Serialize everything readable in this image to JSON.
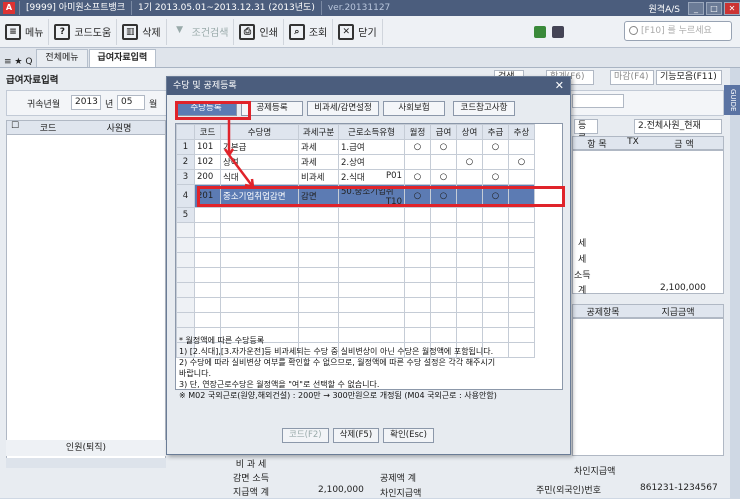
{
  "titlebar": {
    "app": "A",
    "company": "[9999] 아미원소프트뱅크",
    "period": "1기 2013.05.01~2013.12.31 (2013년도)",
    "version": "ver.20131127",
    "remote": "원격A/S"
  },
  "toolbar": {
    "items": [
      {
        "label": "메뉴",
        "icon": "menu-icon"
      },
      {
        "label": "코드도움",
        "icon": "help-icon"
      },
      {
        "label": "삭제",
        "icon": "trash-icon"
      },
      {
        "label": "조건검색",
        "icon": "filter-icon"
      },
      {
        "label": "인쇄",
        "icon": "print-icon"
      },
      {
        "label": "조회",
        "icon": "search-icon"
      },
      {
        "label": "닫기",
        "icon": "close-icon"
      }
    ],
    "search_placeholder": "[F10] 를 누르세요"
  },
  "tabs": [
    {
      "label": "전체메뉴"
    },
    {
      "label": "급여자료입력"
    }
  ],
  "bg": {
    "title": "급여자료입력",
    "year_label": "귀속년월",
    "year": "2013",
    "year_unit": "년",
    "month": "05",
    "month_unit": "월",
    "top_buttons": [
      "검색",
      "합계(F6)",
      "마감(F4)",
      "기능모음(F11)"
    ],
    "right_combo": "2.전체사원_현재",
    "right_btn": "등록",
    "col_code": "코드",
    "col_name": "사원명",
    "rh_item": "항 목",
    "rh_tx": "TX",
    "rh_amount": "금 액",
    "rows": [
      "세",
      "세",
      "소득",
      "계"
    ],
    "total": "2,100,000",
    "ded_item": "공제항목",
    "ded_amount": "지급금액",
    "left_footer": "인원(퇴직)",
    "bottom": [
      {
        "l": "비 과 세",
        "v": ""
      },
      {
        "l": "감면 소득",
        "v": ""
      },
      {
        "l": "지급액 계",
        "v": "2,100,000"
      }
    ],
    "bottom2": [
      "공제액 계",
      "차인지급액"
    ],
    "resid_label": "주민(외국인)번호",
    "resid": "861231-1234567",
    "chain": "차인지급액"
  },
  "modal": {
    "title": "수당 및 공제등록",
    "tabs": [
      "수당등록",
      "공제등록",
      "비과세/감면설정",
      "사회보험",
      "코드참고사항"
    ],
    "headers": [
      "코드",
      "수당명",
      "과세구분",
      "근로소득유형",
      "월정",
      "급여",
      "상여",
      "추급",
      "추상"
    ],
    "rows": [
      {
        "no": "1",
        "code": "101",
        "name": "기본급",
        "tax": "과세",
        "type": "1.급여",
        "f": "",
        "c": [
          "○",
          "○",
          "",
          "○",
          ""
        ]
      },
      {
        "no": "2",
        "code": "102",
        "name": "상여",
        "tax": "과세",
        "type": "2.상여",
        "f": "",
        "c": [
          "",
          "",
          "○",
          "",
          "○"
        ]
      },
      {
        "no": "3",
        "code": "200",
        "name": "식대",
        "tax": "비과세",
        "type": "2.식대",
        "f": "P01",
        "c": [
          "○",
          "○",
          "",
          "○",
          ""
        ]
      },
      {
        "no": "4",
        "code": "201",
        "name": "중소기업취업감면",
        "tax": "감면",
        "type": "50.중소기업취",
        "f": "T10",
        "c": [
          "○",
          "○",
          "",
          "○",
          ""
        ]
      },
      {
        "no": "5",
        "code": "",
        "name": "",
        "tax": "",
        "type": "",
        "f": "",
        "c": [
          "",
          "",
          "",
          "",
          ""
        ]
      }
    ],
    "notes": [
      "* 월정액에 따른 수당등록",
      "1) [2.식대],[3.자가운전]등 비과세되는 수당 중 실비변상이 아닌 수당은 월정액에 포함됩니다.",
      "2) 수당에 따라 실비변상 여부를 확인할 수 없으므로, 월정액에 따른 수당 설정은 각각 해주시기",
      "   바랍니다.",
      "3) 단, 연장근로수당은 월정액을 \"여\"로 선택할 수 없습니다.",
      "※ M02 국외근로(원양,해외건설) : 200만 → 300만원으로 개정됨 (M04 국외근로 : 사용안함)"
    ],
    "buttons": [
      "코드(F2)",
      "삭제(F5)",
      "확인(Esc)"
    ]
  }
}
